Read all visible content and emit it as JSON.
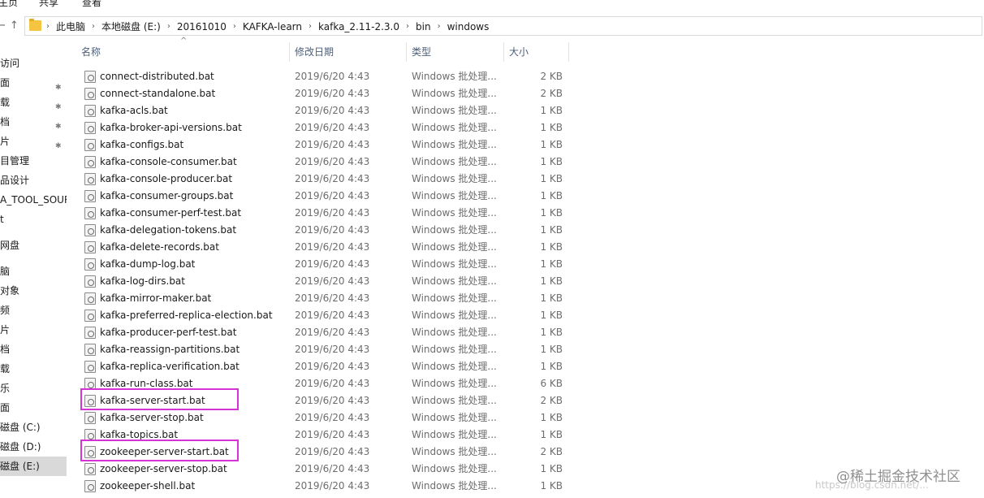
{
  "ribbon": {
    "tabs": [
      "主页",
      "共享",
      "查看"
    ]
  },
  "nav": {
    "back_glyph": "←",
    "up_glyph": "↑",
    "breadcrumbs": [
      "此电脑",
      "本地磁盘 (E:)",
      "20161010",
      "KAFKA-learn",
      "kafka_2.11-2.3.0",
      "bin",
      "windows"
    ],
    "separator": "›"
  },
  "sidebar": {
    "items": [
      {
        "label": "访问",
        "pinned": false,
        "selected": false
      },
      {
        "label": "面",
        "pinned": true,
        "selected": false
      },
      {
        "label": "载",
        "pinned": true,
        "selected": false
      },
      {
        "label": "档",
        "pinned": true,
        "selected": false
      },
      {
        "label": "片",
        "pinned": true,
        "selected": false
      },
      {
        "label": "目管理",
        "pinned": false,
        "selected": false
      },
      {
        "label": "品设计",
        "pinned": false,
        "selected": false
      },
      {
        "label": "A_TOOL_SOUR",
        "pinned": false,
        "selected": false
      },
      {
        "label": "t",
        "pinned": false,
        "selected": false
      },
      {
        "label": "网盘",
        "pinned": false,
        "selected": false
      },
      {
        "label": "",
        "pinned": false,
        "selected": false
      },
      {
        "label": "脑",
        "pinned": false,
        "selected": false
      },
      {
        "label": "对象",
        "pinned": false,
        "selected": false
      },
      {
        "label": "频",
        "pinned": false,
        "selected": false
      },
      {
        "label": "片",
        "pinned": false,
        "selected": false
      },
      {
        "label": "档",
        "pinned": false,
        "selected": false
      },
      {
        "label": "载",
        "pinned": false,
        "selected": false
      },
      {
        "label": "乐",
        "pinned": false,
        "selected": false
      },
      {
        "label": "面",
        "pinned": false,
        "selected": false
      },
      {
        "label": "磁盘 (C:)",
        "pinned": false,
        "selected": false
      },
      {
        "label": "磁盘 (D:)",
        "pinned": false,
        "selected": false
      },
      {
        "label": "磁盘 (E:)",
        "pinned": false,
        "selected": true
      }
    ],
    "pin_glyph": "📌"
  },
  "columns": {
    "name": "名称",
    "date": "修改日期",
    "type": "类型",
    "size": "大小",
    "sort_glyph": "^"
  },
  "files": [
    {
      "name": "connect-distributed.bat",
      "date": "2019/6/20 4:43",
      "type": "Windows 批处理...",
      "size": "2 KB"
    },
    {
      "name": "connect-standalone.bat",
      "date": "2019/6/20 4:43",
      "type": "Windows 批处理...",
      "size": "2 KB"
    },
    {
      "name": "kafka-acls.bat",
      "date": "2019/6/20 4:43",
      "type": "Windows 批处理...",
      "size": "1 KB"
    },
    {
      "name": "kafka-broker-api-versions.bat",
      "date": "2019/6/20 4:43",
      "type": "Windows 批处理...",
      "size": "1 KB"
    },
    {
      "name": "kafka-configs.bat",
      "date": "2019/6/20 4:43",
      "type": "Windows 批处理...",
      "size": "1 KB"
    },
    {
      "name": "kafka-console-consumer.bat",
      "date": "2019/6/20 4:43",
      "type": "Windows 批处理...",
      "size": "1 KB"
    },
    {
      "name": "kafka-console-producer.bat",
      "date": "2019/6/20 4:43",
      "type": "Windows 批处理...",
      "size": "1 KB"
    },
    {
      "name": "kafka-consumer-groups.bat",
      "date": "2019/6/20 4:43",
      "type": "Windows 批处理...",
      "size": "1 KB"
    },
    {
      "name": "kafka-consumer-perf-test.bat",
      "date": "2019/6/20 4:43",
      "type": "Windows 批处理...",
      "size": "1 KB"
    },
    {
      "name": "kafka-delegation-tokens.bat",
      "date": "2019/6/20 4:43",
      "type": "Windows 批处理...",
      "size": "1 KB"
    },
    {
      "name": "kafka-delete-records.bat",
      "date": "2019/6/20 4:43",
      "type": "Windows 批处理...",
      "size": "1 KB"
    },
    {
      "name": "kafka-dump-log.bat",
      "date": "2019/6/20 4:43",
      "type": "Windows 批处理...",
      "size": "1 KB"
    },
    {
      "name": "kafka-log-dirs.bat",
      "date": "2019/6/20 4:43",
      "type": "Windows 批处理...",
      "size": "1 KB"
    },
    {
      "name": "kafka-mirror-maker.bat",
      "date": "2019/6/20 4:43",
      "type": "Windows 批处理...",
      "size": "1 KB"
    },
    {
      "name": "kafka-preferred-replica-election.bat",
      "date": "2019/6/20 4:43",
      "type": "Windows 批处理...",
      "size": "1 KB"
    },
    {
      "name": "kafka-producer-perf-test.bat",
      "date": "2019/6/20 4:43",
      "type": "Windows 批处理...",
      "size": "1 KB"
    },
    {
      "name": "kafka-reassign-partitions.bat",
      "date": "2019/6/20 4:43",
      "type": "Windows 批处理...",
      "size": "1 KB"
    },
    {
      "name": "kafka-replica-verification.bat",
      "date": "2019/6/20 4:43",
      "type": "Windows 批处理...",
      "size": "1 KB"
    },
    {
      "name": "kafka-run-class.bat",
      "date": "2019/6/20 4:43",
      "type": "Windows 批处理...",
      "size": "6 KB"
    },
    {
      "name": "kafka-server-start.bat",
      "date": "2019/6/20 4:43",
      "type": "Windows 批处理...",
      "size": "2 KB"
    },
    {
      "name": "kafka-server-stop.bat",
      "date": "2019/6/20 4:43",
      "type": "Windows 批处理...",
      "size": "1 KB"
    },
    {
      "name": "kafka-topics.bat",
      "date": "2019/6/20 4:43",
      "type": "Windows 批处理...",
      "size": "1 KB"
    },
    {
      "name": "zookeeper-server-start.bat",
      "date": "2019/6/20 4:43",
      "type": "Windows 批处理...",
      "size": "2 KB"
    },
    {
      "name": "zookeeper-server-stop.bat",
      "date": "2019/6/20 4:43",
      "type": "Windows 批处理...",
      "size": "1 KB"
    },
    {
      "name": "zookeeper-shell.bat",
      "date": "2019/6/20 4:43",
      "type": "Windows 批处理...",
      "size": "1 KB"
    }
  ],
  "highlighted_rows": [
    19,
    22
  ],
  "highlight_color": "#d633d6",
  "watermark": {
    "text": "@稀土掘金技术社区",
    "url": "https://blog.csdn.net/..."
  }
}
